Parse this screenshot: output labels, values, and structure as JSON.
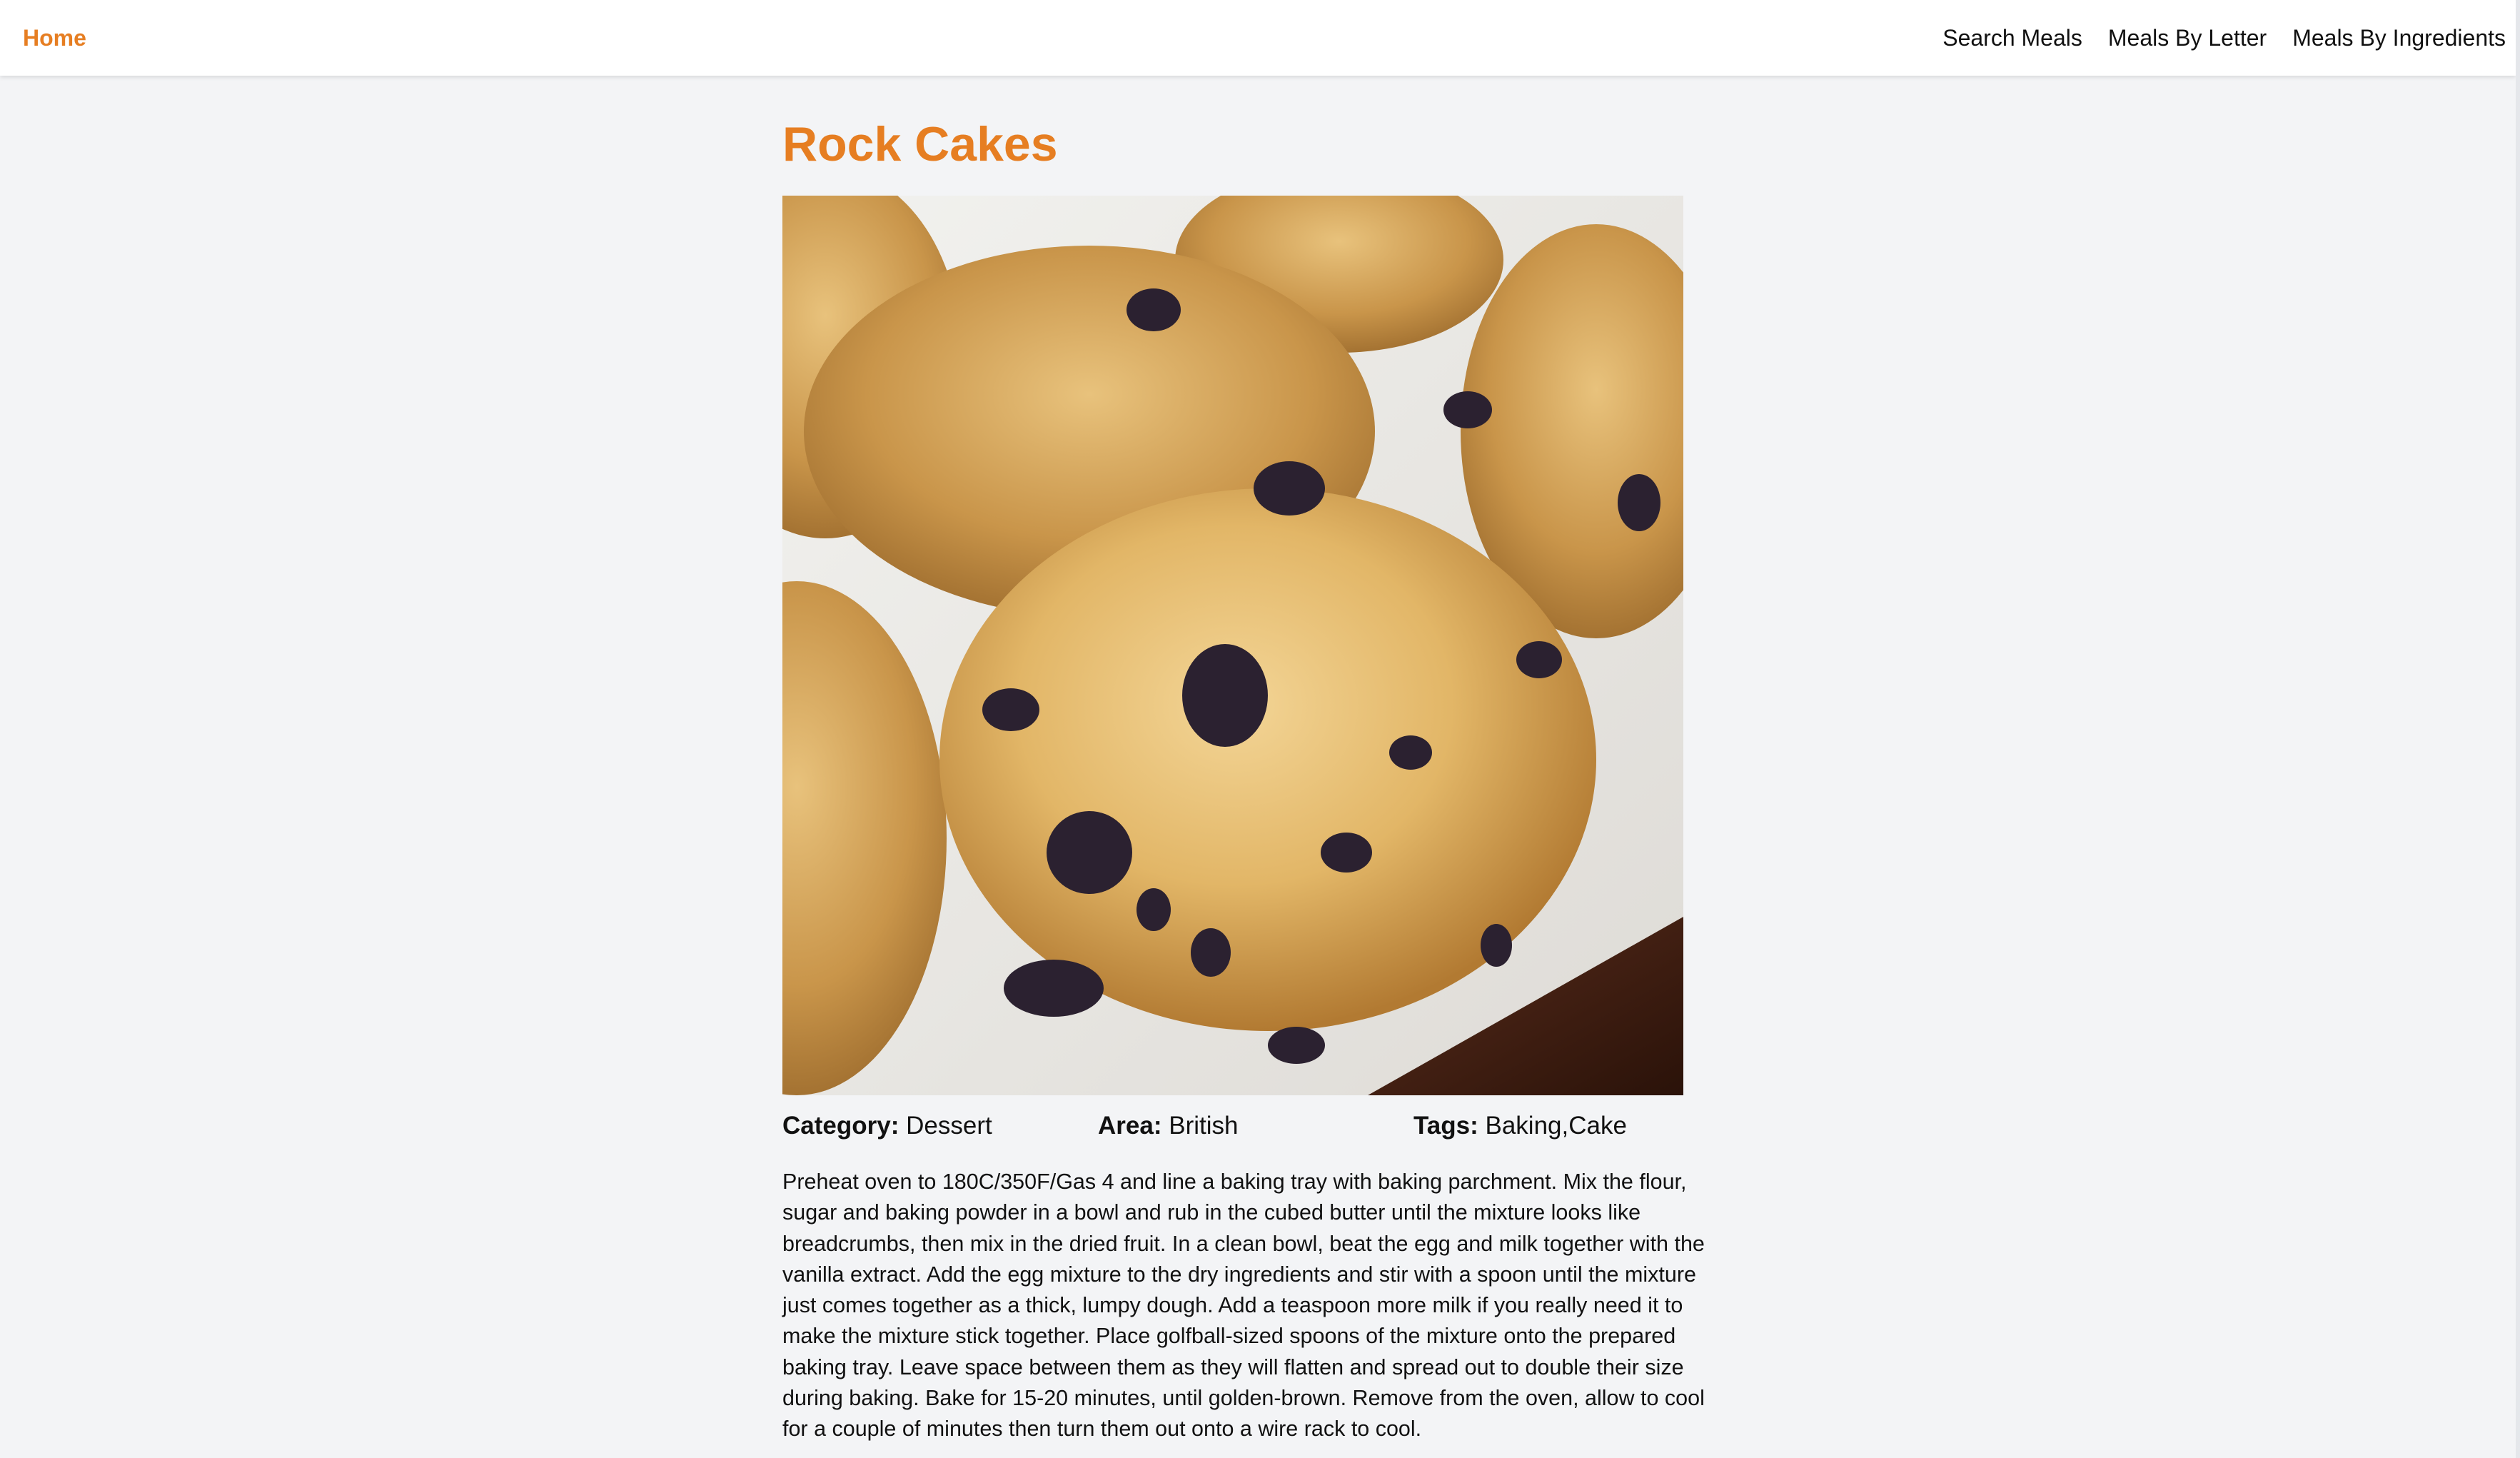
{
  "nav": {
    "home": "Home",
    "links": [
      "Search Meals",
      "Meals By Letter",
      "Meals By Ingredients"
    ]
  },
  "meal": {
    "title": "Rock Cakes",
    "category_label": "Category:",
    "category": "Dessert",
    "area_label": "Area:",
    "area": "British",
    "tags_label": "Tags:",
    "tags": "Baking,Cake",
    "instructions": "Preheat oven to 180C/350F/Gas 4 and line a baking tray with baking parchment. Mix the flour, sugar and baking powder in a bowl and rub in the cubed butter until the mixture looks like breadcrumbs, then mix in the dried fruit. In a clean bowl, beat the egg and milk together with the vanilla extract. Add the egg mixture to the dry ingredients and stir with a spoon until the mixture just comes together as a thick, lumpy dough. Add a teaspoon more milk if you really need it to make the mixture stick together. Place golfball-sized spoons of the mixture onto the prepared baking tray. Leave space between them as they will flatten and spread out to double their size during baking. Bake for 15-20 minutes, until golden-brown. Remove from the oven, allow to cool for a couple of minutes then turn them out onto a wire rack to cool."
  },
  "colors": {
    "accent": "#e67e22",
    "background": "#f3f4f6",
    "navbar": "#ffffff"
  }
}
